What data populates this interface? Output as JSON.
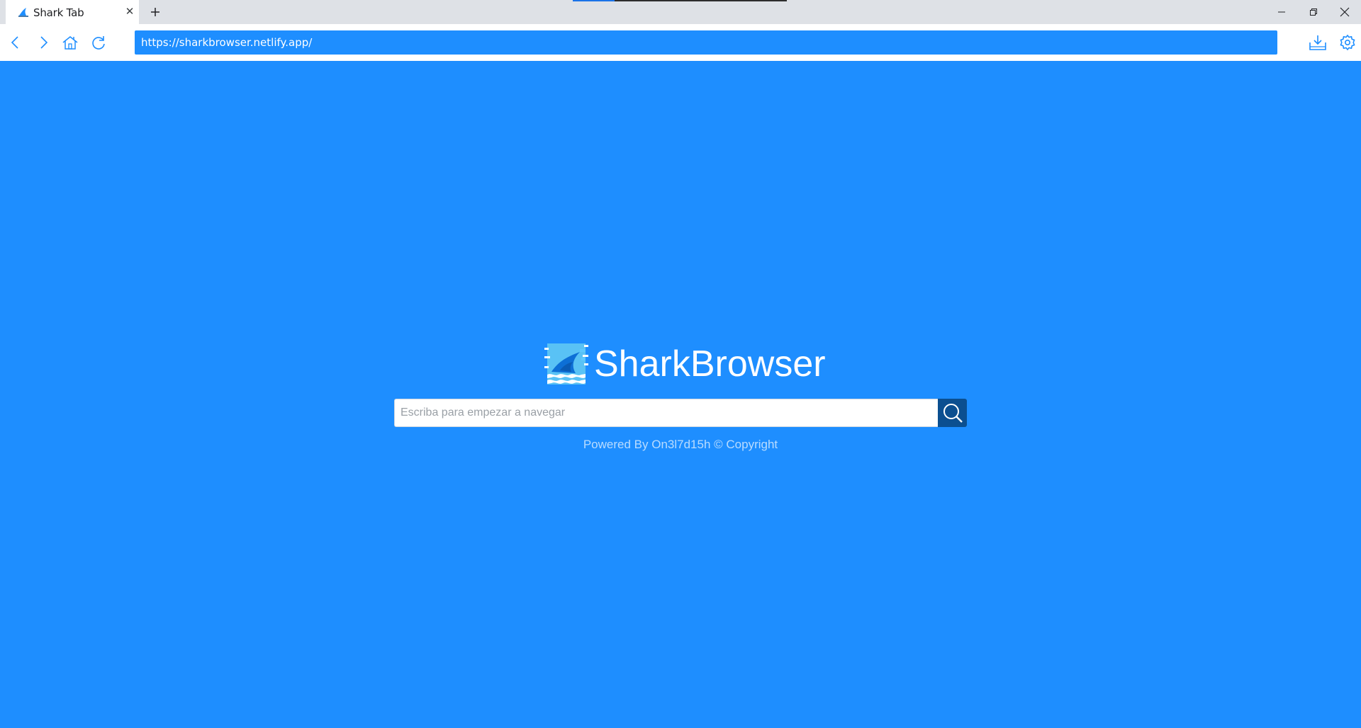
{
  "tab": {
    "title": "Shark Tab",
    "close_glyph": "✕",
    "new_tab_glyph": "+"
  },
  "window": {
    "minimize": "minimize-icon",
    "restore": "restore-icon",
    "close": "close-icon"
  },
  "toolbar": {
    "url": "https://sharkbrowser.netlify.app/",
    "icons": [
      "back-icon",
      "forward-icon",
      "home-icon",
      "reload-icon",
      "download-icon",
      "settings-icon"
    ]
  },
  "page": {
    "brand_name": "SharkBrowser",
    "search_placeholder": "Escriba para empezar a navegar",
    "footer": "Powered By On3l7d15h © Copyright"
  },
  "colors": {
    "page_background": "#1e8eff",
    "search_button": "#0b4f90",
    "accent": "#1e8eff",
    "tabstrip": "#dee1e6"
  }
}
